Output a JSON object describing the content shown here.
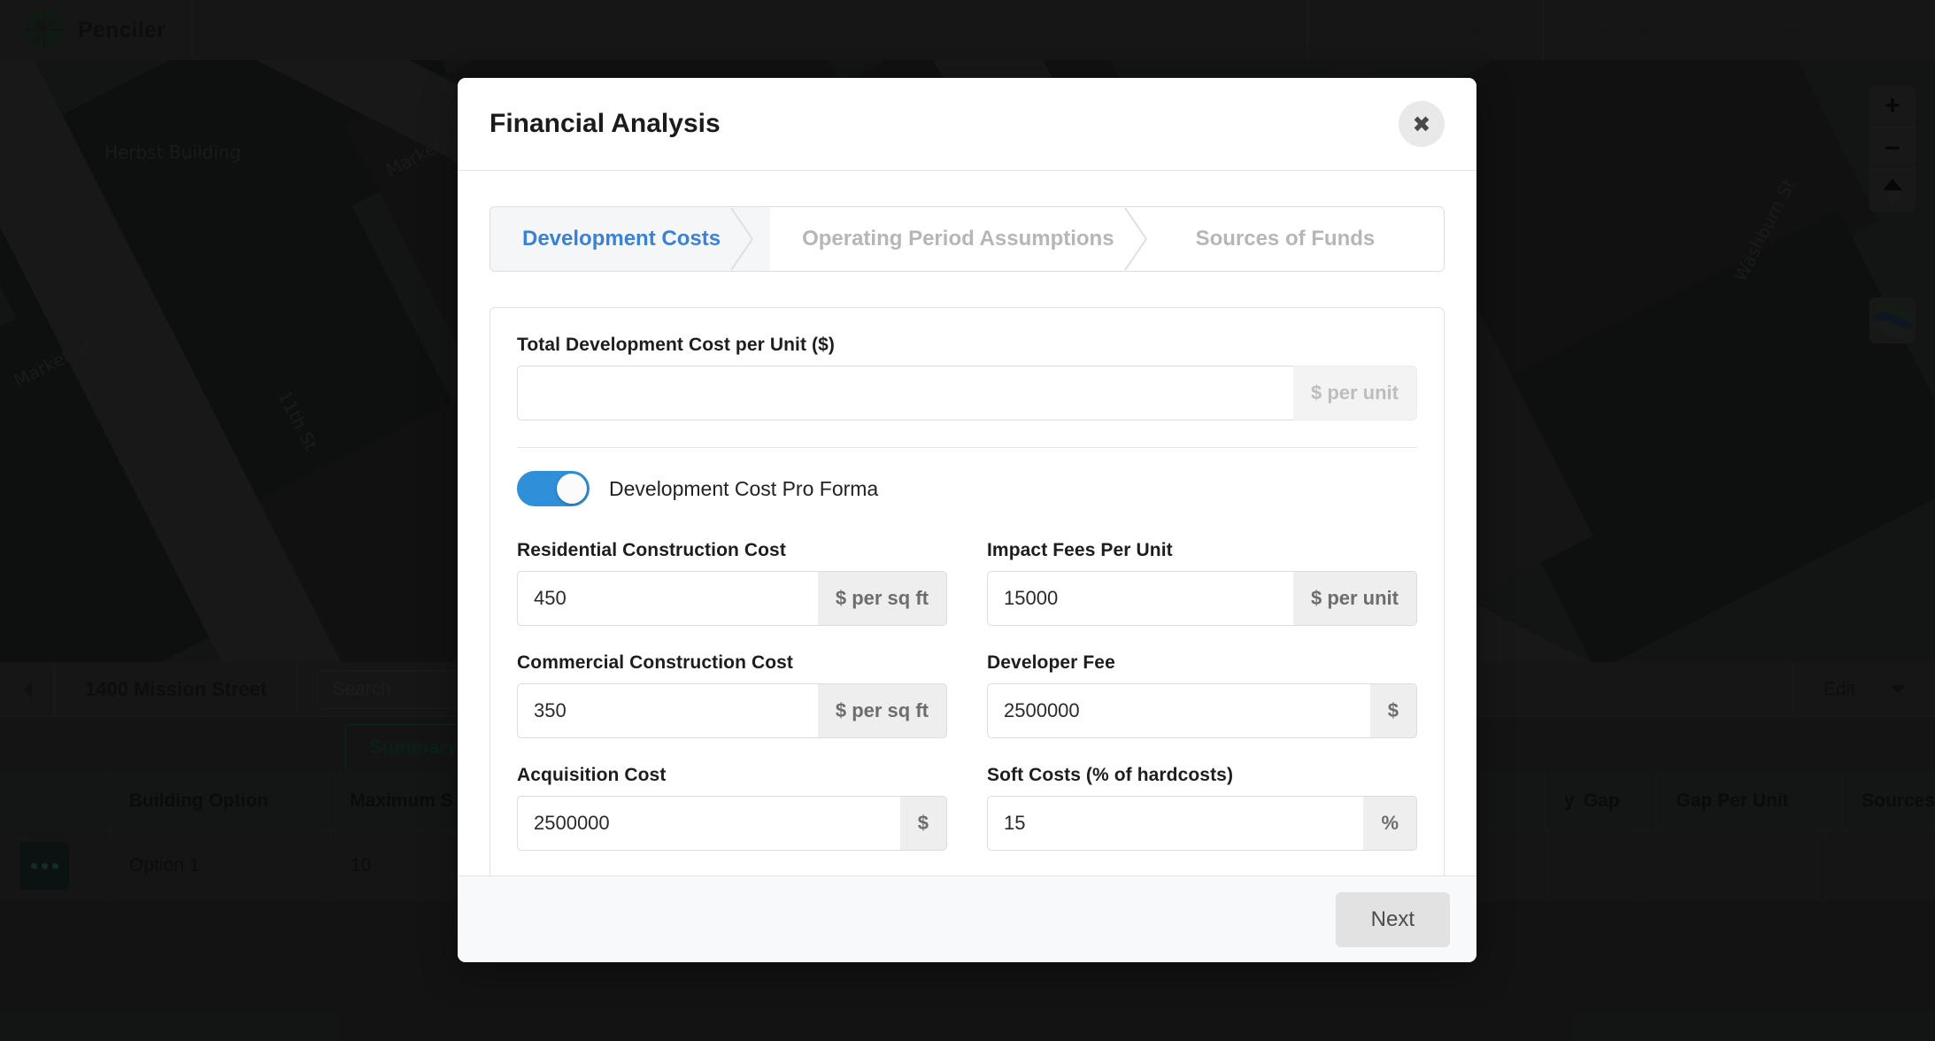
{
  "topnav": {
    "brand": "Penciler",
    "logo_icon": "globe-grid-icon",
    "project_menu": "Project Information",
    "user_menu": "christiana+tutorial@urbansim.com"
  },
  "map": {
    "labels": [
      "Herbst Building",
      "Market St",
      "11th St",
      "Market St",
      "Washburn St"
    ],
    "controls": {
      "zoom_in": "+",
      "zoom_out": "−",
      "compass_icon": "compass-icon",
      "layers_icon": "layers-icon"
    }
  },
  "project_toolbar": {
    "back_icon": "chevron-left-icon",
    "title": "1400 Mission Street",
    "search_placeholder": "Search",
    "edit_label": "Edit",
    "edit_caret_icon": "chevron-down-icon"
  },
  "tabs": {
    "active": "Summary"
  },
  "table": {
    "headers": [
      "",
      "Building Option",
      "Maximum S",
      "y",
      "Gap",
      "Gap Per Unit",
      "Sources"
    ],
    "rows": [
      {
        "menu_icon": "ellipsis-icon",
        "option": "Option 1",
        "max": "10"
      }
    ]
  },
  "modal": {
    "title": "Financial Analysis",
    "close_icon": "close-icon",
    "steps": [
      {
        "label": "Development Costs",
        "active": true
      },
      {
        "label": "Operating Period Assumptions",
        "active": false
      },
      {
        "label": "Sources of Funds",
        "active": false
      }
    ],
    "total_cost": {
      "label": "Total Development Cost per Unit ($)",
      "value": "",
      "placeholder": "",
      "addon": "$ per unit"
    },
    "toggle": {
      "label": "Development Cost Pro Forma",
      "on": true,
      "color": "#2f8fd8"
    },
    "fields": [
      {
        "label": "Residential Construction Cost",
        "value": "450",
        "addon": "$ per sq ft"
      },
      {
        "label": "Impact Fees Per Unit",
        "value": "15000",
        "addon": "$ per unit"
      },
      {
        "label": "Commercial Construction Cost",
        "value": "350",
        "addon": "$ per sq ft"
      },
      {
        "label": "Developer Fee",
        "value": "2500000",
        "addon": "$"
      },
      {
        "label": "Acquisition Cost",
        "value": "2500000",
        "addon": "$"
      },
      {
        "label": "Soft Costs (% of hardcosts)",
        "value": "15",
        "addon": "%"
      }
    ],
    "footer": {
      "next_label": "Next"
    }
  }
}
